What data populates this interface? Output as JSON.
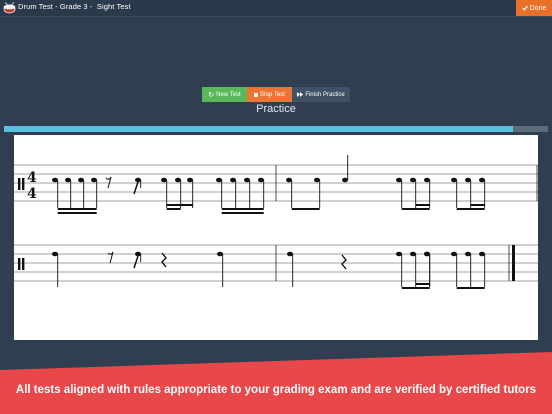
{
  "header": {
    "title": "Drum Test - Grade 3 -  Sight Test",
    "app_icon": "drum-icon",
    "done_label": "Done",
    "done_icon": "check-icon"
  },
  "controls": {
    "new_test": {
      "label": "New Test",
      "icon": "refresh-icon",
      "color": "#5cb85c"
    },
    "stop_test": {
      "label": "Stop Test",
      "icon": "stop-icon",
      "color": "#ee7436"
    },
    "finish_practice": {
      "label": "Finish Practice",
      "icon": "fast-forward-icon",
      "color": "#3f5164"
    }
  },
  "mode_label": "Practice",
  "progress": {
    "fraction": 0.935,
    "color": "#5bc0de"
  },
  "score": {
    "time_signature": {
      "top": "4",
      "bottom": "4"
    }
  },
  "banner": {
    "text": "All tests aligned with rules appropriate to your grading exam and are verified by certified tutors",
    "color": "#e8484a"
  },
  "colors": {
    "background": "#2f3f51",
    "topbar": "#2b3a4b",
    "accent": "#e8702a"
  }
}
